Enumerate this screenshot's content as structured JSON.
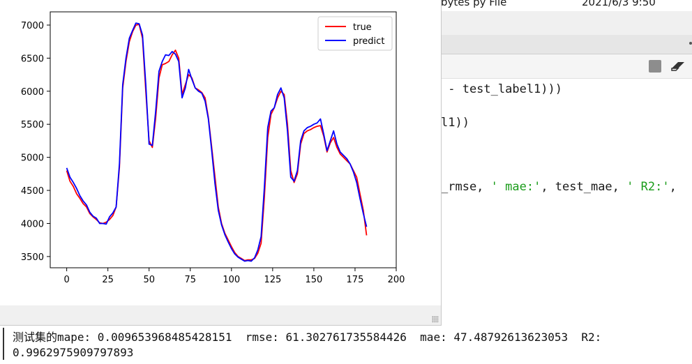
{
  "ide": {
    "file_header_size": "bytes py File",
    "file_header_date": "2021/6/3 9:50",
    "code_lines": [
      {
        "parts": [
          {
            "t": " - test_label1)))",
            "s": false
          }
        ]
      },
      {
        "parts": [
          {
            "t": "l1))",
            "s": false
          }
        ]
      },
      {
        "parts": [
          {
            "t": "_rmse, ",
            "s": false
          },
          {
            "t": "' mae:'",
            "s": true
          },
          {
            "t": ", test_mae, ",
            "s": false
          },
          {
            "t": "' R2:'",
            "s": true
          },
          {
            "t": ",",
            "s": false
          }
        ]
      }
    ],
    "console_line1": "测试集的mape: 0.009653968485428151  rmse: 61.302761735584426  mae: 47.48792613623053  R2:",
    "console_line2": "0.9962975909797893"
  },
  "toolbar": {
    "stop_icon": "stop-square-icon",
    "clear_icon": "eraser-icon"
  },
  "chart_data": {
    "type": "line",
    "xlim": [
      -10,
      200
    ],
    "ylim": [
      3330,
      7200
    ],
    "xticks": [
      0,
      25,
      50,
      75,
      100,
      125,
      150,
      175,
      200
    ],
    "yticks": [
      3500,
      4000,
      4500,
      5000,
      5500,
      6000,
      6500,
      7000
    ],
    "legend_position": "top-right",
    "grid": false,
    "series": [
      {
        "name": "true",
        "color": "#ff0000",
        "points": [
          [
            0,
            4800
          ],
          [
            2,
            4640
          ],
          [
            4,
            4560
          ],
          [
            6,
            4450
          ],
          [
            8,
            4380
          ],
          [
            10,
            4300
          ],
          [
            12,
            4250
          ],
          [
            14,
            4150
          ],
          [
            16,
            4100
          ],
          [
            18,
            4060
          ],
          [
            20,
            4010
          ],
          [
            22,
            4000
          ],
          [
            24,
            4020
          ],
          [
            26,
            4060
          ],
          [
            28,
            4120
          ],
          [
            30,
            4250
          ],
          [
            32,
            4850
          ],
          [
            34,
            6050
          ],
          [
            36,
            6450
          ],
          [
            38,
            6750
          ],
          [
            40,
            6900
          ],
          [
            42,
            7000
          ],
          [
            44,
            7010
          ],
          [
            46,
            6800
          ],
          [
            48,
            6000
          ],
          [
            50,
            5250
          ],
          [
            52,
            5150
          ],
          [
            54,
            5600
          ],
          [
            56,
            6200
          ],
          [
            58,
            6400
          ],
          [
            60,
            6420
          ],
          [
            62,
            6450
          ],
          [
            64,
            6550
          ],
          [
            66,
            6620
          ],
          [
            68,
            6500
          ],
          [
            70,
            5950
          ],
          [
            72,
            6100
          ],
          [
            74,
            6250
          ],
          [
            76,
            6200
          ],
          [
            78,
            6050
          ],
          [
            80,
            6020
          ],
          [
            82,
            5980
          ],
          [
            84,
            5900
          ],
          [
            86,
            5600
          ],
          [
            88,
            5150
          ],
          [
            90,
            4700
          ],
          [
            92,
            4250
          ],
          [
            94,
            4000
          ],
          [
            96,
            3850
          ],
          [
            98,
            3750
          ],
          [
            100,
            3650
          ],
          [
            102,
            3560
          ],
          [
            104,
            3500
          ],
          [
            106,
            3470
          ],
          [
            108,
            3440
          ],
          [
            110,
            3450
          ],
          [
            112,
            3450
          ],
          [
            114,
            3470
          ],
          [
            116,
            3550
          ],
          [
            118,
            3700
          ],
          [
            120,
            4400
          ],
          [
            122,
            5300
          ],
          [
            124,
            5650
          ],
          [
            126,
            5750
          ],
          [
            128,
            5900
          ],
          [
            130,
            6000
          ],
          [
            132,
            5950
          ],
          [
            134,
            5500
          ],
          [
            136,
            4800
          ],
          [
            138,
            4620
          ],
          [
            140,
            4750
          ],
          [
            142,
            5200
          ],
          [
            144,
            5360
          ],
          [
            146,
            5400
          ],
          [
            148,
            5420
          ],
          [
            150,
            5450
          ],
          [
            152,
            5470
          ],
          [
            154,
            5480
          ],
          [
            156,
            5320
          ],
          [
            158,
            5080
          ],
          [
            160,
            5220
          ],
          [
            162,
            5300
          ],
          [
            164,
            5150
          ],
          [
            166,
            5050
          ],
          [
            168,
            5000
          ],
          [
            170,
            4950
          ],
          [
            172,
            4900
          ],
          [
            174,
            4800
          ],
          [
            176,
            4700
          ],
          [
            178,
            4450
          ],
          [
            180,
            4200
          ],
          [
            182,
            3820
          ]
        ]
      },
      {
        "name": "predict",
        "color": "#0000ff",
        "points": [
          [
            0,
            4840
          ],
          [
            2,
            4700
          ],
          [
            4,
            4620
          ],
          [
            6,
            4530
          ],
          [
            8,
            4420
          ],
          [
            10,
            4340
          ],
          [
            12,
            4280
          ],
          [
            14,
            4170
          ],
          [
            16,
            4110
          ],
          [
            18,
            4080
          ],
          [
            20,
            4000
          ],
          [
            22,
            4000
          ],
          [
            24,
            3990
          ],
          [
            26,
            4100
          ],
          [
            28,
            4160
          ],
          [
            30,
            4250
          ],
          [
            32,
            4900
          ],
          [
            34,
            6100
          ],
          [
            36,
            6500
          ],
          [
            38,
            6800
          ],
          [
            40,
            6920
          ],
          [
            42,
            7030
          ],
          [
            44,
            7020
          ],
          [
            46,
            6850
          ],
          [
            48,
            6100
          ],
          [
            50,
            5200
          ],
          [
            52,
            5180
          ],
          [
            54,
            5700
          ],
          [
            56,
            6300
          ],
          [
            58,
            6450
          ],
          [
            60,
            6550
          ],
          [
            62,
            6540
          ],
          [
            64,
            6600
          ],
          [
            66,
            6560
          ],
          [
            68,
            6450
          ],
          [
            70,
            5900
          ],
          [
            72,
            6050
          ],
          [
            74,
            6330
          ],
          [
            76,
            6180
          ],
          [
            78,
            6050
          ],
          [
            80,
            6000
          ],
          [
            82,
            5970
          ],
          [
            84,
            5850
          ],
          [
            86,
            5580
          ],
          [
            88,
            5100
          ],
          [
            90,
            4600
          ],
          [
            92,
            4200
          ],
          [
            94,
            3980
          ],
          [
            96,
            3830
          ],
          [
            98,
            3720
          ],
          [
            100,
            3620
          ],
          [
            102,
            3540
          ],
          [
            104,
            3490
          ],
          [
            106,
            3460
          ],
          [
            108,
            3430
          ],
          [
            110,
            3440
          ],
          [
            112,
            3430
          ],
          [
            114,
            3480
          ],
          [
            116,
            3600
          ],
          [
            118,
            3800
          ],
          [
            120,
            4550
          ],
          [
            122,
            5450
          ],
          [
            124,
            5700
          ],
          [
            126,
            5750
          ],
          [
            128,
            5950
          ],
          [
            130,
            6050
          ],
          [
            132,
            5900
          ],
          [
            134,
            5400
          ],
          [
            136,
            4700
          ],
          [
            138,
            4640
          ],
          [
            140,
            4800
          ],
          [
            142,
            5250
          ],
          [
            144,
            5400
          ],
          [
            146,
            5450
          ],
          [
            148,
            5470
          ],
          [
            150,
            5500
          ],
          [
            152,
            5520
          ],
          [
            154,
            5580
          ],
          [
            156,
            5350
          ],
          [
            158,
            5100
          ],
          [
            160,
            5250
          ],
          [
            162,
            5400
          ],
          [
            164,
            5200
          ],
          [
            166,
            5080
          ],
          [
            168,
            5030
          ],
          [
            170,
            4980
          ],
          [
            172,
            4900
          ],
          [
            174,
            4780
          ],
          [
            176,
            4620
          ],
          [
            178,
            4380
          ],
          [
            180,
            4150
          ],
          [
            182,
            3950
          ]
        ]
      }
    ]
  }
}
